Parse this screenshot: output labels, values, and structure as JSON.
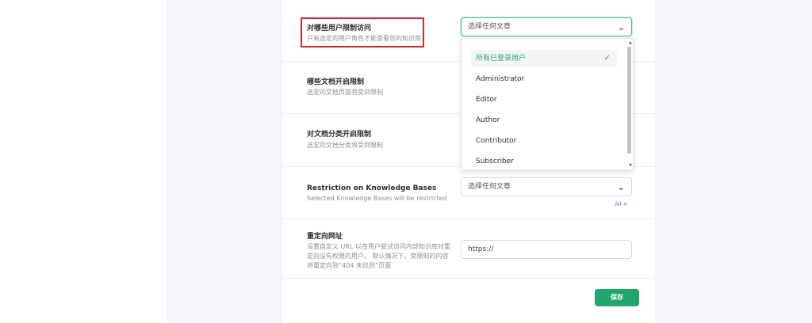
{
  "rows": [
    {
      "label": "对哪些用户限制访问",
      "desc": "只有选定的用户角色才能查看您的知识库"
    },
    {
      "label": "哪些文档开启限制",
      "desc": "选定的文档页面将受到限制"
    },
    {
      "label": "对文档分类开启限制",
      "desc": "选定的文档分类将受到限制"
    },
    {
      "label": "Restriction on Knowledge Bases",
      "desc": "Selected Knowledge Bases will be restricted"
    },
    {
      "label": "重定向网址",
      "desc_lines": [
        "设置自定义 URL 以在用户尝试访问内部知识库时重",
        "定向没有权限的用户。 默认情况下，受限制的内容",
        "将重定向到“404 未找到”页面"
      ]
    }
  ],
  "role_select": {
    "value": "选择任何文章"
  },
  "dropdown": {
    "items": [
      {
        "label": "所有已登录用户",
        "selected": true
      },
      {
        "label": "Administrator",
        "selected": false
      },
      {
        "label": "Editor",
        "selected": false
      },
      {
        "label": "Author",
        "selected": false
      },
      {
        "label": "Contributor",
        "selected": false
      },
      {
        "label": "Subscriber",
        "selected": false
      }
    ]
  },
  "kb_select": {
    "value": "选择任何文章"
  },
  "kb_tag": {
    "label": "All",
    "remove": "×"
  },
  "redirect_input": {
    "placeholder": "https://"
  },
  "save_label": "保存",
  "colors": {
    "accent": "#1fa76e",
    "highlight": "#e0242b",
    "tag": "#7b61ff"
  },
  "icons": {
    "chevron": "chevron-down-icon",
    "check": "check-icon"
  }
}
